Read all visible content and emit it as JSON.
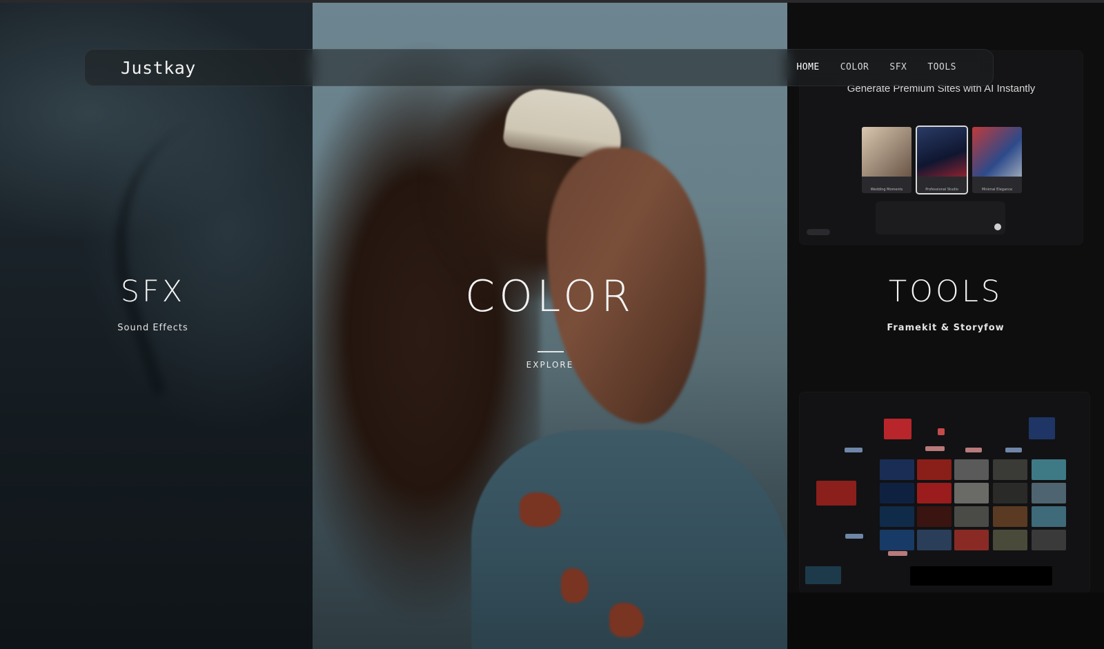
{
  "brand": {
    "logo": "Justkay"
  },
  "nav": {
    "items": [
      {
        "label": "HOME",
        "active": true
      },
      {
        "label": "COLOR",
        "active": false
      },
      {
        "label": "SFX",
        "active": false
      },
      {
        "label": "TOOLS",
        "active": false
      }
    ]
  },
  "sections": {
    "sfx": {
      "title": "SFX",
      "subtitle": "Sound Effects"
    },
    "color": {
      "title": "COLOR",
      "cta": "EXPLORE"
    },
    "tools": {
      "title": "TOOLS",
      "subtitle": "Framekit & Storyfow"
    }
  },
  "tools_preview": {
    "headline": "Generate Premium Sites with AI Instantly",
    "templates": [
      "Wedding Moments",
      "Professional Studio",
      "Minimal Elegance"
    ]
  },
  "colors": {
    "accent_red": "#b8262c",
    "accent_blue": "#1f3566",
    "node_blue": "#6f86a8",
    "node_pink": "#b97a7a"
  }
}
